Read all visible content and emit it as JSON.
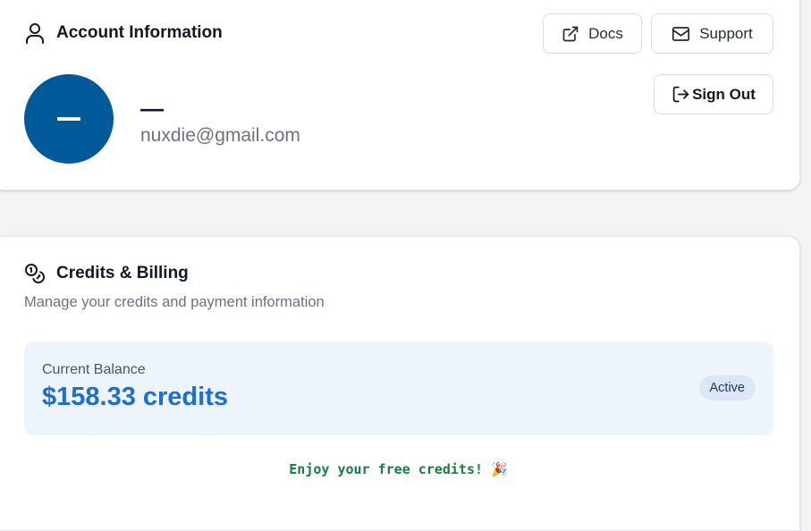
{
  "account": {
    "title": "Account Information",
    "icon": "user-icon",
    "buttons": {
      "docs": {
        "label": "Docs",
        "icon": "external-link-icon"
      },
      "support": {
        "label": "Support",
        "icon": "mail-icon"
      },
      "sign_out": {
        "label": "Sign Out",
        "icon": "sign-out-icon"
      }
    },
    "user": {
      "avatar_initial": "–",
      "name": "—",
      "email": "nuxdie@gmail.com"
    }
  },
  "credits": {
    "title": "Credits & Billing",
    "icon": "coins-icon",
    "subtitle": "Manage your credits and payment information",
    "balance": {
      "label": "Current Balance",
      "value": "$158.33 credits",
      "status": "Active"
    },
    "promo": {
      "text": "Enjoy your free credits!",
      "emoji": "🎉"
    }
  },
  "colors": {
    "avatar_bg": "#005a99",
    "balance_text": "#1a6fd1",
    "balance_bg": "#eef4fc",
    "promo_text": "#15803d"
  }
}
